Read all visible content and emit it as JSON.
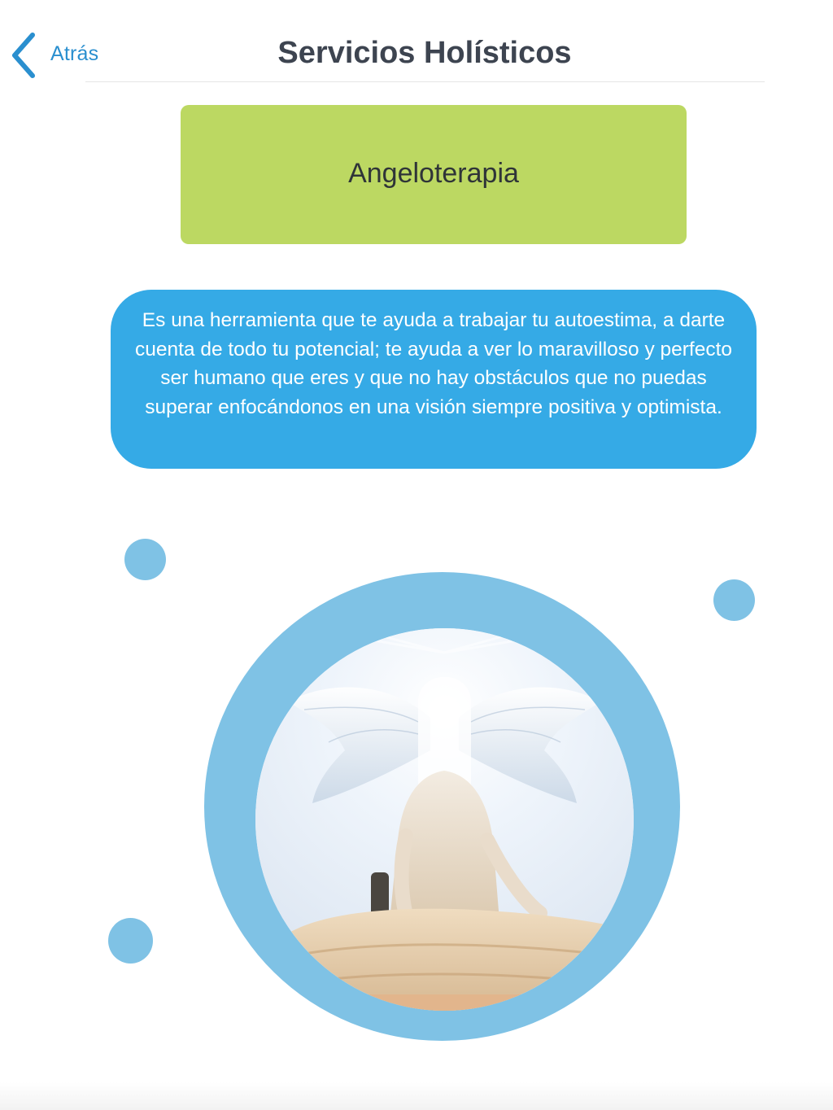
{
  "nav": {
    "back_label": "Atrás",
    "title": "Servicios Holísticos"
  },
  "service": {
    "name": "Angeloterapia",
    "description": "Es una herramienta que te ayuda a trabajar tu autoestima, a darte cuenta de todo tu potencial; te ayuda a ver lo maravilloso y perfecto ser humano que eres y que no hay obstáculos que no puedas superar enfocándonos en una visión siempre positiva y optimista."
  },
  "colors": {
    "accent_blue": "#35aae6",
    "ring_blue": "#7fc2e5",
    "card_green": "#bcd862",
    "back_link": "#2a8fcf"
  },
  "icons": {
    "back": "chevron-left-icon"
  },
  "image": {
    "subject": "angel-wings-therapy-photo"
  }
}
